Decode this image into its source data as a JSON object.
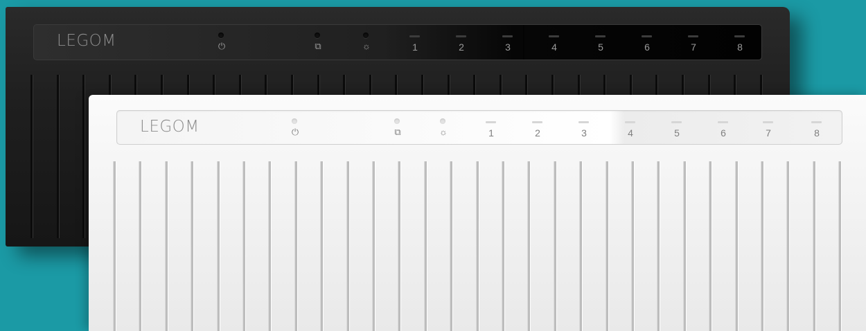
{
  "scene": {
    "background_color": "#1b9aa5"
  },
  "devices": [
    {
      "variant": "black",
      "brand": "LEGOM",
      "indicators": [
        {
          "icon": "power-icon",
          "symbol": "⏻"
        },
        {
          "icon": "network-icon",
          "symbol": "⧉"
        },
        {
          "icon": "activity-icon",
          "symbol": "☼"
        }
      ],
      "ports": [
        "1",
        "2",
        "3",
        "4",
        "5",
        "6",
        "7",
        "8"
      ],
      "colors": {
        "body": "#1f1f1f",
        "text": "#9a9a9a"
      }
    },
    {
      "variant": "white",
      "brand": "LEGOM",
      "indicators": [
        {
          "icon": "power-icon",
          "symbol": "⏻"
        },
        {
          "icon": "network-icon",
          "symbol": "⧉"
        },
        {
          "icon": "activity-icon",
          "symbol": "☼"
        }
      ],
      "ports": [
        "1",
        "2",
        "3",
        "4",
        "5",
        "6",
        "7",
        "8"
      ],
      "colors": {
        "body": "#f2f2f2",
        "text": "#7f7f7f"
      }
    }
  ]
}
